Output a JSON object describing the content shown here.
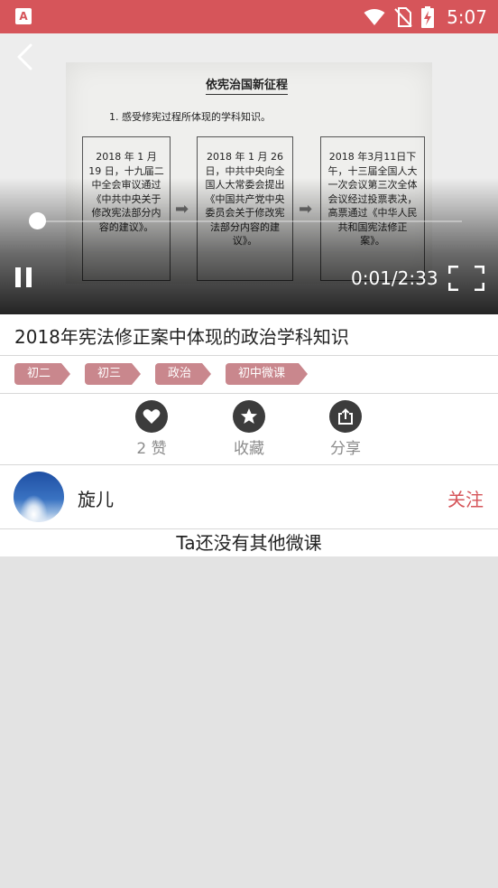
{
  "status_bar": {
    "app_icon_letter": "A",
    "time": "5:07",
    "bg_color": "#d6555a"
  },
  "video": {
    "paper": {
      "title": "依宪治国新征程",
      "subtitle": "1. 感受修宪过程所体现的学科知识。",
      "boxes": [
        "2018 年 1 月 19 日，十九届二中全会审议通过《中共中央关于修改宪法部分内容的建议》。",
        "2018 年 1 月 26 日，中共中央向全国人大常委会提出《中国共产党中央委员会关于修改宪法部分内容的建议》。",
        "2018 年3月11日下午，十三届全国人大一次会议第三次全体会议经过投票表决，高票通过《中华人民共和国宪法修正案》。"
      ]
    },
    "progress_fraction": 0.007,
    "time_label": "0:01/2:33",
    "icons": [
      "back-icon",
      "pause-icon",
      "fullscreen-icon"
    ]
  },
  "lesson": {
    "title": "2018年宪法修正案中体现的政治学科知识",
    "tags": [
      "初二",
      "初三",
      "政治",
      "初中微课"
    ],
    "tag_color": "#c9878d"
  },
  "actions": [
    {
      "name": "like",
      "icon": "heart-icon",
      "label": "2 赞"
    },
    {
      "name": "favorite",
      "icon": "star-icon",
      "label": "收藏"
    },
    {
      "name": "share",
      "icon": "share-icon",
      "label": "分享"
    }
  ],
  "author": {
    "name": "旋儿",
    "follow_label": "关注",
    "accent_color": "#d6555a"
  },
  "more": {
    "empty_text": "Ta还没有其他微课"
  }
}
